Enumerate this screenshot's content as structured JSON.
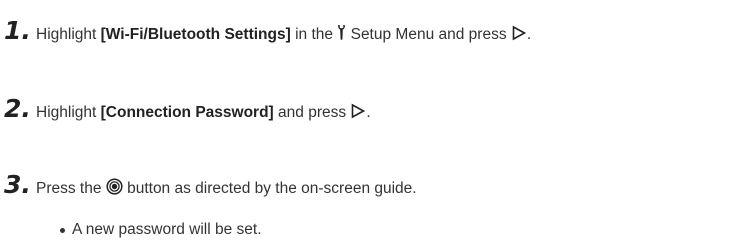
{
  "steps": [
    {
      "number": "1.",
      "text_before": "Highlight ",
      "bold": "[Wi-Fi/Bluetooth Settings]",
      "text_middle": " in the ",
      "icon_a": "wrench-setup-icon",
      "text_after_icon": " Setup Menu and press ",
      "icon_b": "right-triangle-arrow-icon",
      "text_end": "."
    },
    {
      "number": "2.",
      "text_before": "Highlight ",
      "bold": "[Connection Password]",
      "text_middle": " and press ",
      "icon_b": "right-triangle-arrow-icon",
      "text_end": "."
    },
    {
      "number": "3.",
      "text_before": "Press the ",
      "icon_a": "ok-button-circle-icon",
      "text_after_icon": " button as directed by the on-screen guide.",
      "bullets": [
        "A new password will be set."
      ]
    }
  ]
}
